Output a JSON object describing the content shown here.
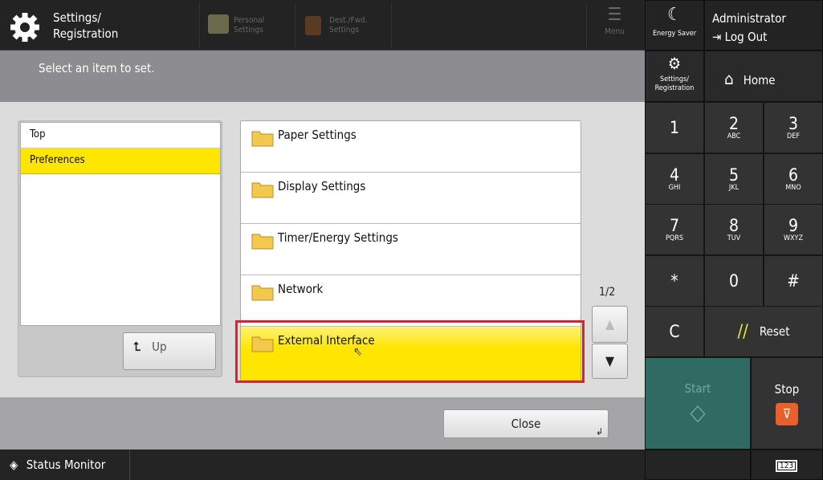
{
  "header": {
    "title_line1": "Settings/",
    "title_line2": "Registration",
    "tabs": [
      {
        "line1": "Personal",
        "line2": "Settings"
      },
      {
        "line1": "Dest./Fwd.",
        "line2": "Settings"
      }
    ],
    "menu_label": "Menu"
  },
  "side_header": {
    "energy_saver": "Energy Saver",
    "user": "Administrator",
    "logout": "Log Out",
    "settings_line1": "Settings/",
    "settings_line2": "Registration",
    "home": "Home"
  },
  "banner": {
    "instruction": "Select an item to set."
  },
  "tree": {
    "items": [
      {
        "label": "Top"
      },
      {
        "label": "Preferences",
        "selected": true
      }
    ],
    "up_label": "Up"
  },
  "items": [
    {
      "label": "Paper Settings"
    },
    {
      "label": "Display Settings"
    },
    {
      "label": "Timer/Energy Settings"
    },
    {
      "label": "Network"
    },
    {
      "label": "External Interface",
      "selected": true
    }
  ],
  "pager": {
    "page": "1/2"
  },
  "close_label": "Close",
  "keypad": [
    {
      "n": "1",
      "s": ""
    },
    {
      "n": "2",
      "s": "ABC"
    },
    {
      "n": "3",
      "s": "DEF"
    },
    {
      "n": "4",
      "s": "GHI"
    },
    {
      "n": "5",
      "s": "JKL"
    },
    {
      "n": "6",
      "s": "MNO"
    },
    {
      "n": "7",
      "s": "PQRS"
    },
    {
      "n": "8",
      "s": "TUV"
    },
    {
      "n": "9",
      "s": "WXYZ"
    },
    {
      "n": "*",
      "s": ""
    },
    {
      "n": "0",
      "s": ""
    },
    {
      "n": "#",
      "s": ""
    }
  ],
  "clear_label": "C",
  "reset_label": "Reset",
  "start_label": "Start",
  "stop_label": "Stop",
  "status_monitor": "Status Monitor",
  "counter_label": "123",
  "colors": {
    "highlight": "#ffe600",
    "selection_outline": "#e0202a",
    "start": "#2f6b63",
    "stop": "#e8602c"
  }
}
